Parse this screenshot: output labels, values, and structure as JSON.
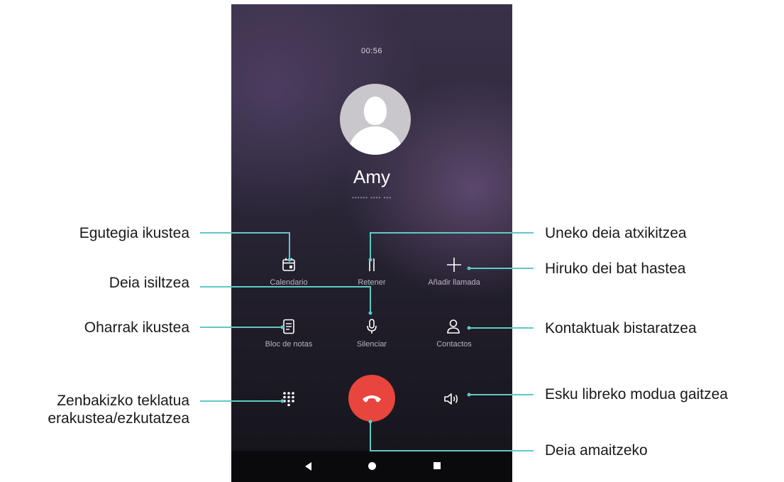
{
  "call": {
    "timer": "00:56",
    "caller_name": "Amy",
    "caller_number": "•••••• ••••  •••"
  },
  "buttons": {
    "calendar_label": "Calendario",
    "hold_label": "Retener",
    "add_call_label": "Añadir llamada",
    "notes_label": "Bloc de notas",
    "mute_label": "Silenciar",
    "contacts_label": "Contactos"
  },
  "callouts": {
    "calendar": "Egutegia ikustea",
    "mute": "Deia isiltzea",
    "notes": "Oharrak ikustea",
    "dialpad_line1": "Zenbakizko teklatua",
    "dialpad_line2": "erakustea/ezkutatzea",
    "hold": "Uneko deia atxikitzea",
    "add_call": "Hiruko dei bat hastea",
    "contacts": "Kontaktuak bistaratzea",
    "speaker": "Esku libreko modua gaitzea",
    "end_call": "Deia amaitzeko"
  },
  "icons": {
    "calendar": "calendar-icon",
    "hold": "pause-icon",
    "add_call": "plus-icon",
    "notes": "notes-icon",
    "mute": "microphone-icon",
    "contacts": "contacts-icon",
    "dialpad": "dialpad-icon",
    "end_call": "phone-hangup-icon",
    "speaker": "speaker-icon"
  },
  "colors": {
    "end_call": "#e8453c",
    "callout_line": "#5fc9c6",
    "callout_text": "#1a1a1a"
  }
}
